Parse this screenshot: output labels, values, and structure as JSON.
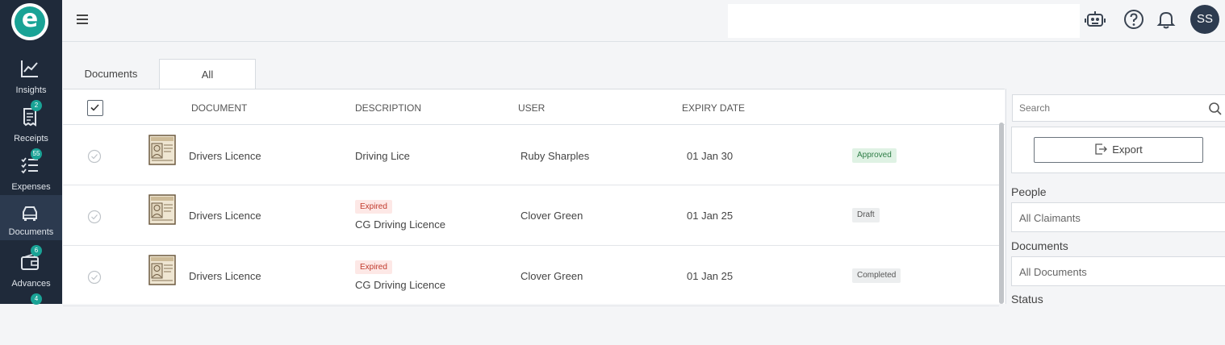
{
  "app": {
    "logo_letter": "e",
    "accent_color": "#1aa396",
    "sidebar_color": "#1f2a3a"
  },
  "sidebar": {
    "items": [
      {
        "label": "Insights",
        "icon": "chart-line-icon",
        "badge": ""
      },
      {
        "label": "Receipts",
        "icon": "receipt-icon",
        "badge": "2"
      },
      {
        "label": "Expenses",
        "icon": "checklist-icon",
        "badge": "55"
      },
      {
        "label": "Documents",
        "icon": "car-icon",
        "badge": "",
        "active": true
      },
      {
        "label": "Advances",
        "icon": "wallet-icon",
        "badge": "6"
      },
      {
        "label": "",
        "icon": "more-icon",
        "badge": "4"
      }
    ]
  },
  "header": {
    "avatar_initials": "SS",
    "icons": [
      "robot-icon",
      "help-icon",
      "bell-icon"
    ]
  },
  "tabs": [
    {
      "label": "Documents",
      "active": false
    },
    {
      "label": "All",
      "active": true
    }
  ],
  "table": {
    "columns": [
      "DOCUMENT",
      "DESCRIPTION",
      "USER",
      "EXPIRY DATE"
    ],
    "rows": [
      {
        "document": "Drivers Licence",
        "expired": "",
        "description": "Driving Lice",
        "user": "Ruby Sharples",
        "expiry": "01 Jan 30",
        "status": "Approved"
      },
      {
        "document": "Drivers Licence",
        "expired": "Expired",
        "description": "CG Driving Licence",
        "user": "Clover Green",
        "expiry": "01 Jan 25",
        "status": "Draft"
      },
      {
        "document": "Drivers Licence",
        "expired": "Expired",
        "description": "CG Driving Licence",
        "user": "Clover Green",
        "expiry": "01 Jan 25",
        "status": "Completed"
      }
    ]
  },
  "panel": {
    "search_placeholder": "Search",
    "export_label": "Export",
    "filters": [
      {
        "label": "People",
        "value": "All Claimants"
      },
      {
        "label": "Documents",
        "value": "All Documents"
      },
      {
        "label": "Status",
        "value": ""
      }
    ]
  }
}
